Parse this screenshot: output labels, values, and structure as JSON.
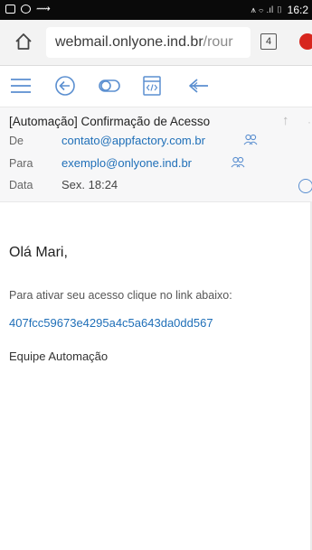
{
  "status_bar": {
    "time": "16:2",
    "signal_text": "‡ ≈ .∥ ∥"
  },
  "browser": {
    "url_host": "webmail.onlyone.ind.br",
    "url_path": "/rour",
    "tab_count": "4"
  },
  "email": {
    "subject": "[Automação] Confirmação de Acesso",
    "from_label": "De",
    "from_value": "contato@appfactory.com.br",
    "to_label": "Para",
    "to_value": "exemplo@onlyone.ind.br",
    "date_label": "Data",
    "date_value": "Sex. 18:24",
    "greeting": "Olá Mari,",
    "paragraph": "Para ativar seu acesso clique no link abaixo:",
    "code_link": "407fcc59673e4295a4c5a643da0dd567",
    "signoff": "Equipe Automação"
  },
  "colors": {
    "link": "#1f6fb8",
    "toolbar_icon": "#5b8fd0",
    "brand_red": "#d7261e"
  }
}
